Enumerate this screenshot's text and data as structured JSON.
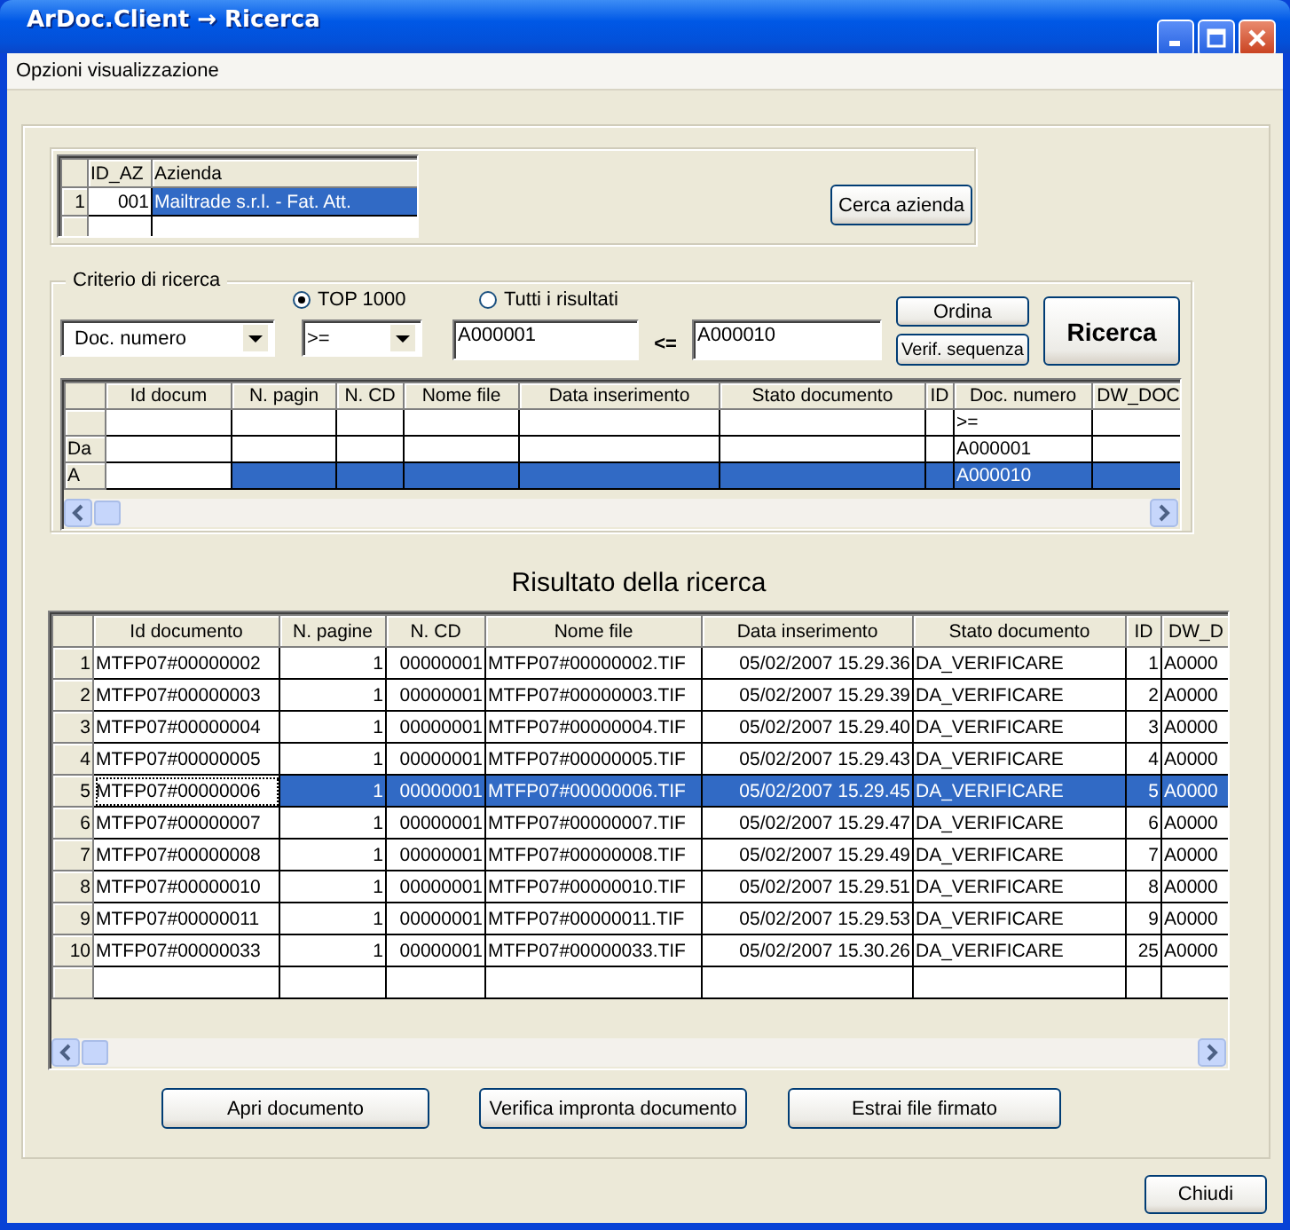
{
  "window": {
    "title": "ArDoc.Client → Ricerca"
  },
  "menu": [
    {
      "label": "Opzioni visualizzazione"
    }
  ],
  "company_grid": {
    "columns": [
      "ID_AZ",
      "Azienda"
    ],
    "rows": [
      {
        "header": "1",
        "cells": [
          "001",
          "Mailtrade s.r.l. - Fat. Att."
        ],
        "selected": true
      },
      {
        "selected": false
      }
    ]
  },
  "search_company_button": "Cerca azienda",
  "criteria": {
    "legend": "Criterio di ricerca",
    "radios": [
      {
        "label": "TOP 1000",
        "selected": true
      },
      {
        "label": "Tutti i risultati",
        "selected": false
      }
    ],
    "field_select": {
      "value": "Doc. numero"
    },
    "operator_select": {
      "value": ">="
    },
    "from_field": {
      "value": "A000001"
    },
    "range_label": "<=",
    "to_field": {
      "value": "A000010"
    },
    "order_button": "Ordina",
    "verify_button": "Verif. sequenza",
    "search_button": "Ricerca"
  },
  "criteria_grid": {
    "columns": [
      "Id docum",
      "N. pagin",
      "N. CD",
      "Nome file",
      "Data inserimento",
      "Stato documento",
      "ID",
      "Doc. numero",
      "DW_DOC"
    ],
    "rows": [
      {
        "doc_numero": ">=",
        "selected": false
      },
      {
        "header": "Da",
        "doc_numero": "A000001",
        "selected": false
      },
      {
        "header": "A",
        "doc_numero": "A000010",
        "selected": true
      }
    ]
  },
  "results_title": "Risultato della ricerca",
  "results_grid": {
    "columns": [
      "Id documento",
      "N. pagine",
      "N. CD",
      "Nome file",
      "Data inserimento",
      "Stato documento",
      "ID",
      "DW_D"
    ],
    "rows": [
      {
        "header": "1",
        "cells": [
          "MTFP07#00000002",
          "1",
          "00000001",
          "MTFP07#00000002.TIF",
          "05/02/2007 15.29.36",
          "DA_VERIFICARE",
          "1",
          "A0000"
        ],
        "selected": false
      },
      {
        "header": "2",
        "cells": [
          "MTFP07#00000003",
          "1",
          "00000001",
          "MTFP07#00000003.TIF",
          "05/02/2007 15.29.39",
          "DA_VERIFICARE",
          "2",
          "A0000"
        ],
        "selected": false
      },
      {
        "header": "3",
        "cells": [
          "MTFP07#00000004",
          "1",
          "00000001",
          "MTFP07#00000004.TIF",
          "05/02/2007 15.29.40",
          "DA_VERIFICARE",
          "3",
          "A0000"
        ],
        "selected": false
      },
      {
        "header": "4",
        "cells": [
          "MTFP07#00000005",
          "1",
          "00000001",
          "MTFP07#00000005.TIF",
          "05/02/2007 15.29.43",
          "DA_VERIFICARE",
          "4",
          "A0000"
        ],
        "selected": false
      },
      {
        "header": "5",
        "cells": [
          "MTFP07#00000006",
          "1",
          "00000001",
          "MTFP07#00000006.TIF",
          "05/02/2007 15.29.45",
          "DA_VERIFICARE",
          "5",
          "A0000"
        ],
        "selected": true
      },
      {
        "header": "6",
        "cells": [
          "MTFP07#00000007",
          "1",
          "00000001",
          "MTFP07#00000007.TIF",
          "05/02/2007 15.29.47",
          "DA_VERIFICARE",
          "6",
          "A0000"
        ],
        "selected": false
      },
      {
        "header": "7",
        "cells": [
          "MTFP07#00000008",
          "1",
          "00000001",
          "MTFP07#00000008.TIF",
          "05/02/2007 15.29.49",
          "DA_VERIFICARE",
          "7",
          "A0000"
        ],
        "selected": false
      },
      {
        "header": "8",
        "cells": [
          "MTFP07#00000010",
          "1",
          "00000001",
          "MTFP07#00000010.TIF",
          "05/02/2007 15.29.51",
          "DA_VERIFICARE",
          "8",
          "A0000"
        ],
        "selected": false
      },
      {
        "header": "9",
        "cells": [
          "MTFP07#00000011",
          "1",
          "00000001",
          "MTFP07#00000011.TIF",
          "05/02/2007 15.29.53",
          "DA_VERIFICARE",
          "9",
          "A0000"
        ],
        "selected": false
      },
      {
        "header": "10",
        "cells": [
          "MTFP07#00000033",
          "1",
          "00000001",
          "MTFP07#00000033.TIF",
          "05/02/2007 15.30.26",
          "DA_VERIFICARE",
          "25",
          "A0000"
        ],
        "selected": false
      }
    ]
  },
  "action_buttons": [
    "Apri documento",
    "Verifica impronta documento",
    "Estrai file firmato"
  ],
  "close_button": "Chiudi"
}
